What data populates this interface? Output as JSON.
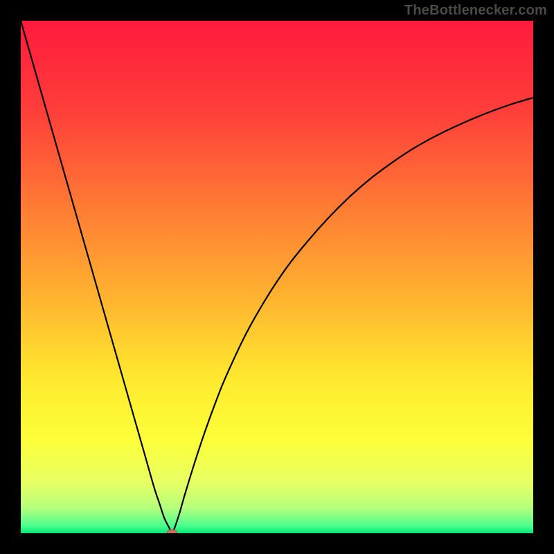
{
  "watermark": "TheBottlenecker.com",
  "colors": {
    "frame": "#000000",
    "curve": "#000000",
    "marker_fill": "#c77060",
    "marker_stroke": "#a85648",
    "gradient_stops": [
      {
        "offset": 0.0,
        "color": "#ff1a3c"
      },
      {
        "offset": 0.18,
        "color": "#ff3f3a"
      },
      {
        "offset": 0.36,
        "color": "#ff7a34"
      },
      {
        "offset": 0.54,
        "color": "#ffb330"
      },
      {
        "offset": 0.7,
        "color": "#ffe92e"
      },
      {
        "offset": 0.82,
        "color": "#fcff3a"
      },
      {
        "offset": 0.9,
        "color": "#e8ff63"
      },
      {
        "offset": 0.95,
        "color": "#b6ff7a"
      },
      {
        "offset": 0.985,
        "color": "#4eff8e"
      },
      {
        "offset": 1.0,
        "color": "#00e876"
      }
    ]
  },
  "chart_data": {
    "type": "line",
    "title": "",
    "xlabel": "",
    "ylabel": "",
    "xlim": [
      0,
      100
    ],
    "ylim": [
      0,
      100
    ],
    "min_marker": {
      "x": 29.5,
      "y": 0
    },
    "series": [
      {
        "name": "curve",
        "x": [
          0,
          2,
          4,
          6,
          8,
          10,
          12,
          14,
          16,
          18,
          20,
          22,
          24,
          26,
          27,
          28,
          29,
          29.5,
          30,
          31,
          32,
          34,
          36,
          38,
          40,
          44,
          48,
          52,
          56,
          60,
          64,
          68,
          72,
          76,
          80,
          84,
          88,
          92,
          96,
          100
        ],
        "y": [
          100,
          93,
          86,
          79,
          72,
          65,
          58,
          51,
          44,
          37,
          30,
          23,
          16,
          9,
          6,
          3,
          1,
          0,
          1,
          4,
          7.5,
          14,
          20,
          25.5,
          30.5,
          39,
          46,
          52,
          57,
          61.5,
          65.5,
          69,
          72,
          74.7,
          77,
          79,
          80.8,
          82.4,
          83.8,
          85
        ]
      }
    ]
  }
}
